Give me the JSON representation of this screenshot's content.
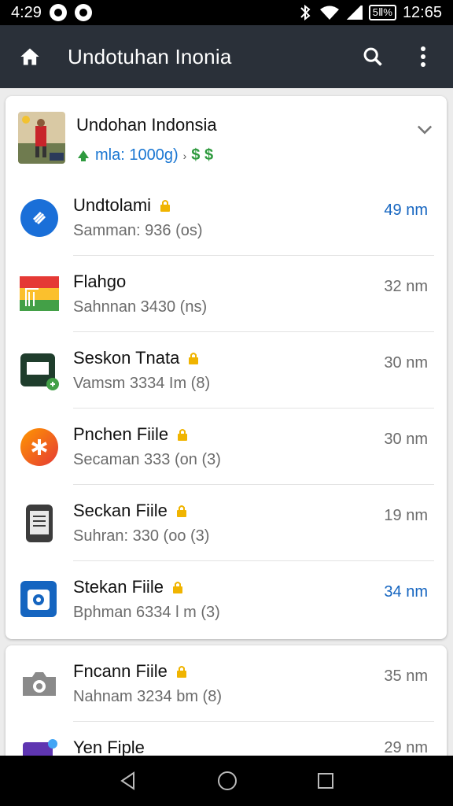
{
  "status_bar": {
    "time_left": "4:29",
    "battery_label": "5Ⅱ%",
    "time_right": "12:65"
  },
  "app_bar": {
    "title": "Undotuhan Inonia",
    "icons": [
      "home-icon",
      "search-icon",
      "more-vert-icon"
    ]
  },
  "header": {
    "title": "Undohan Indonsia",
    "subtitle": "mla: 1000g)",
    "arrow": "›",
    "currency": "$ $"
  },
  "items": [
    {
      "title": "Undtolami",
      "subtitle": "Samman: 936 (os)",
      "time": "49 nm",
      "time_color": "blue",
      "icon": "link-icon"
    },
    {
      "title": "Flahgo",
      "subtitle": "Sahnnan 3430 (ns)",
      "time": "32 nm",
      "time_color": "gray",
      "icon": "flag-app-icon"
    },
    {
      "title": "Seskon Tnata",
      "subtitle": "Vamsm 3334 Im (8)",
      "time": "30 nm",
      "time_color": "gray",
      "icon": "terminal-app-icon"
    },
    {
      "title": "Pnchen Fiile",
      "subtitle": "Secaman 333 (on (3)",
      "time": "30 nm",
      "time_color": "gray",
      "icon": "asterisk-app-icon"
    },
    {
      "title": "Seckan Fiile",
      "subtitle": "Suhran: 330 (oo (3)",
      "time": "19 nm",
      "time_color": "gray",
      "icon": "document-icon"
    },
    {
      "title": "Stekan Fiile",
      "subtitle": "Bphman 6334 l m (3)",
      "time": "34 nm",
      "time_color": "blue",
      "icon": "camera-app-icon"
    }
  ],
  "items_2": [
    {
      "title": "Fncann Fiile",
      "subtitle": "Nahnam 3234 bm (8)",
      "time": "35 nm",
      "icon": "camera-icon"
    },
    {
      "title": "Yen Fiple",
      "subtitle": "",
      "time": "29 nm",
      "icon": "purple-app-icon"
    }
  ],
  "nav": [
    "back-icon",
    "home-circle-icon",
    "recents-icon"
  ],
  "colors": {
    "app_bar": "#2a3039",
    "accent_blue": "#1976d2",
    "green": "#2e9a3e",
    "lock_yellow": "#f0b400"
  }
}
